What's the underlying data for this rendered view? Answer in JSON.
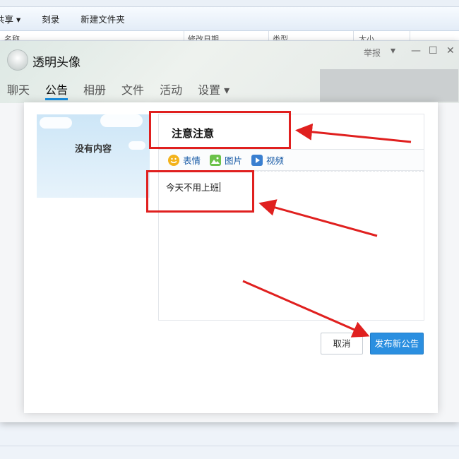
{
  "explorer": {
    "toolbar": [
      "共享 ▾",
      "刻录",
      "新建文件夹"
    ],
    "columns": [
      "名称",
      "修改日期",
      "类型",
      "大小"
    ]
  },
  "window": {
    "group_name": "透明头像",
    "report_label": "举报",
    "controls": [
      "▾",
      "—",
      "☐",
      "✕"
    ],
    "tabs": [
      {
        "label": "聊天"
      },
      {
        "label": "公告"
      },
      {
        "label": "相册"
      },
      {
        "label": "文件"
      },
      {
        "label": "活动"
      },
      {
        "label": "设置 ▾"
      }
    ],
    "active_tab": "公告"
  },
  "dialog": {
    "empty_text": "没有内容",
    "title_value": "注意注意",
    "toolbar": [
      {
        "label": "表情",
        "icon": "emoji-icon",
        "color": "#f3b21b"
      },
      {
        "label": "图片",
        "icon": "image-icon",
        "color": "#6cc24a"
      },
      {
        "label": "视频",
        "icon": "video-icon",
        "color": "#3a7fd0"
      }
    ],
    "body_value": "今天不用上班",
    "cancel_label": "取消",
    "publish_label": "发布新公告"
  },
  "colors": {
    "accent": "#2b8fe0",
    "annotation": "#e0201f"
  }
}
